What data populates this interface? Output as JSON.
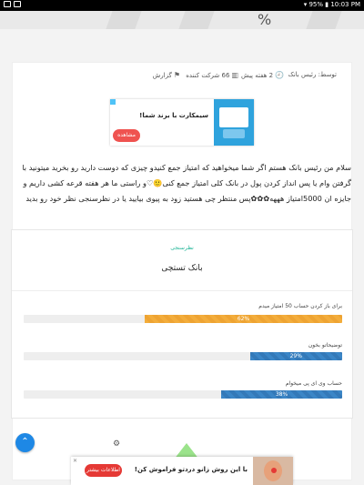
{
  "status_bar": {
    "battery": "95%",
    "time": "10:03 PM"
  },
  "hero": {
    "percent_glyph": "%"
  },
  "meta": {
    "author": "توسط: رئیس بانک",
    "time_ago": "2 هفته پیش",
    "participants": "66 شرکت کننده",
    "report": "گزارش"
  },
  "ad_top": {
    "title": "سیمکارت با برند شما!",
    "button": "مشاهده"
  },
  "post": {
    "paragraph": "سلام من رئیس بانک هستم اگر شما میخواهید که امتیاز جمع کنیدو چیزی که دوست دارید رو بخرید میتونید با گرفتن وام یا پس انداز کردن پول در بانک کلی امتیاز جمع کنی🙂♡و راستی ما هر هفته قرعه کشی داریم و جایزه ان 5000امتیاز هههه✿✿✿پس منتظر چی هستید زود به پیوی بیایید یا در نظرسنجی نظر خود رو بدید"
  },
  "poll": {
    "category": "نظرسنجی",
    "title": "بانک تستچی",
    "options": [
      {
        "label": "برای باز کردن حساب 50 امتیاز میدم",
        "percent": 62,
        "percent_label": "62%",
        "color": "orange"
      },
      {
        "label": "توضیحاتو بخون",
        "percent": 29,
        "percent_label": "29%",
        "color": "blue"
      },
      {
        "label": "حساب وی ای پی میخوام",
        "percent": 38,
        "percent_label": "38%",
        "color": "blue"
      }
    ]
  },
  "ad_bottom": {
    "title": "با این روش زانو دردتو فراموش کن!",
    "button": "اطلاعات بیشتر"
  },
  "colors": {
    "orange_bar": "#f3ad3b",
    "blue_bar": "#3b86c7",
    "ad_button": "#ef5350",
    "scroll_button": "#1e88e5",
    "poll_category": "#1ab394"
  }
}
